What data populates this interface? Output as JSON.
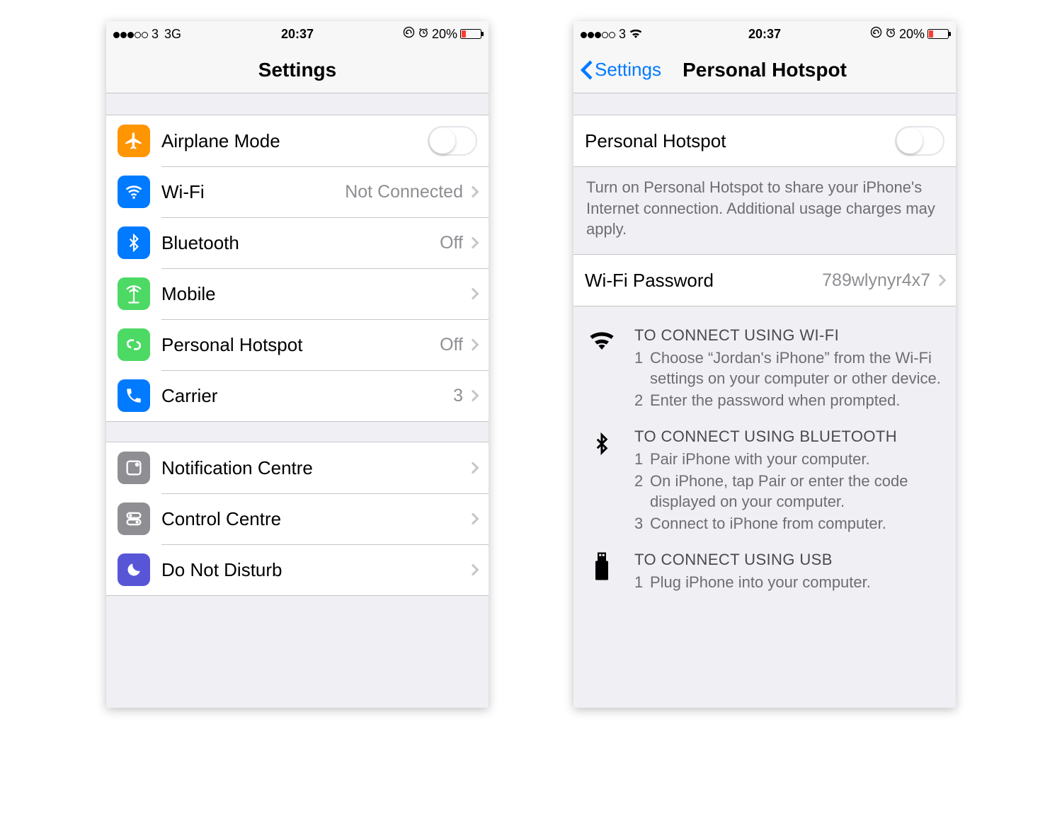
{
  "left": {
    "statusbar": {
      "carrier": "3",
      "signal": "3G",
      "time": "20:37",
      "battery": "20%"
    },
    "nav": {
      "title": "Settings"
    },
    "group1": [
      {
        "label": "Airplane Mode",
        "type": "toggle"
      },
      {
        "label": "Wi-Fi",
        "value": "Not Connected"
      },
      {
        "label": "Bluetooth",
        "value": "Off"
      },
      {
        "label": "Mobile",
        "value": ""
      },
      {
        "label": "Personal Hotspot",
        "value": "Off"
      },
      {
        "label": "Carrier",
        "value": "3"
      }
    ],
    "group2": [
      {
        "label": "Notification Centre"
      },
      {
        "label": "Control Centre"
      },
      {
        "label": "Do Not Disturb"
      }
    ]
  },
  "right": {
    "statusbar": {
      "carrier": "3",
      "time": "20:37",
      "battery": "20%"
    },
    "nav": {
      "back": "Settings",
      "title": "Personal Hotspot"
    },
    "toggle_row": {
      "label": "Personal Hotspot"
    },
    "footer": "Turn on Personal Hotspot to share your iPhone's Internet connection. Additional usage charges may apply.",
    "password_row": {
      "label": "Wi-Fi Password",
      "value": "789wlynyr4x7"
    },
    "wifi": {
      "title": "TO CONNECT USING WI-FI",
      "step1": "Choose “Jordan's iPhone” from the Wi-Fi settings on your computer or other device.",
      "step2": "Enter the password when prompted."
    },
    "bt": {
      "title": "TO CONNECT USING BLUETOOTH",
      "step1": "Pair iPhone with your computer.",
      "step2": "On iPhone, tap Pair or enter the code displayed on your computer.",
      "step3": "Connect to iPhone from computer."
    },
    "usb": {
      "title": "TO CONNECT USING USB",
      "step1": "Plug iPhone into your computer."
    }
  }
}
